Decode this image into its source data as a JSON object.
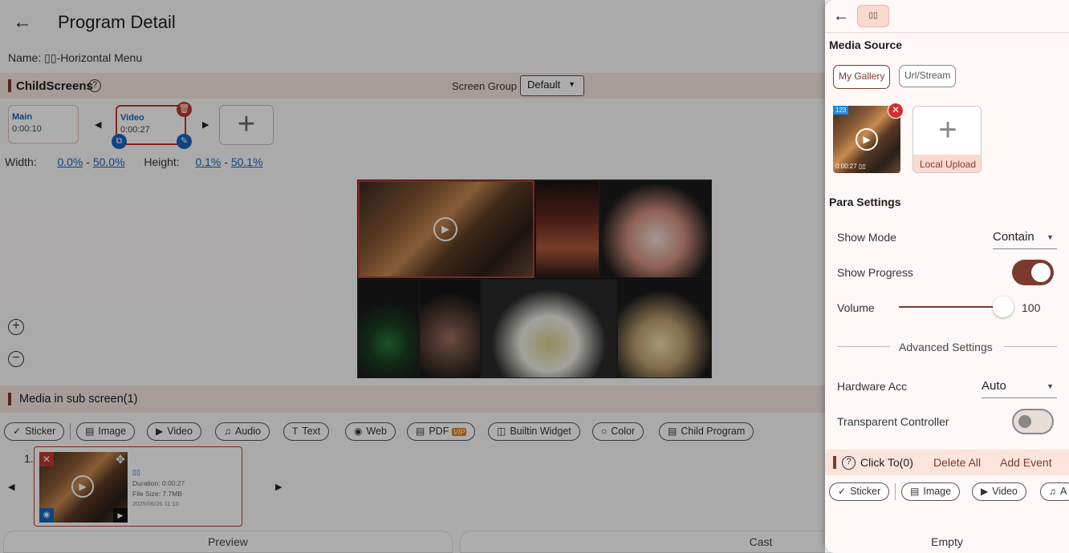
{
  "header": {
    "back_icon": "arrow-left-icon",
    "title": "Program Detail"
  },
  "program": {
    "name_line": "Name: ▯▯-Horizontal Menu"
  },
  "child_screens": {
    "label": "ChildScreens",
    "screen_group_label": "Screen Group",
    "screen_group_value": "Default",
    "items": [
      {
        "title": "Main",
        "duration": "0:00:10"
      },
      {
        "title": "Video",
        "duration": "0:00:27"
      }
    ],
    "dims": {
      "width_label": "Width:",
      "width_from": "0.0%",
      "width_to": "50.0%",
      "height_label": "Height:",
      "height_from": "0.1%",
      "height_to": "50.1%",
      "separator": "-"
    }
  },
  "media_section": {
    "label": "Media in sub screen(1)",
    "chips": [
      "Sticker",
      "Image",
      "Video",
      "Audio",
      "Text",
      "Web",
      "PDF",
      "Builtin Widget",
      "Color",
      "Child Program"
    ],
    "vip_badge": "VIP",
    "index": "1.",
    "item": {
      "title": "▯▯",
      "duration": "Duration: 0:00:27",
      "size": "File Size: 7.7MB",
      "date": "2025/06/26 11:10"
    }
  },
  "bottom": {
    "preview": "Preview",
    "cast": "Cast"
  },
  "panel": {
    "back_icon": "arrow-left-icon",
    "tag": "▯▯",
    "media_source": "Media Source",
    "source_tabs": [
      "My Gallery",
      "Url/Stream"
    ],
    "gallery_badge": "123",
    "gallery_duration": "0:00:27 ▯▯",
    "local_upload": "Local Upload",
    "para_settings": "Para Settings",
    "show_mode_label": "Show Mode",
    "show_mode_value": "Contain",
    "show_progress_label": "Show Progress",
    "show_progress_on": true,
    "volume_label": "Volume",
    "volume_value": "100",
    "volume_level": 1.0,
    "advanced": "Advanced Settings",
    "hw_label": "Hardware Acc",
    "hw_value": "Auto",
    "transparent_label": "Transparent Controller",
    "transparent_on": false,
    "click_to": "Click To(0)",
    "delete_all": "Delete All",
    "add_event": "Add Event",
    "chips": [
      "Sticker",
      "Image",
      "Video",
      "A"
    ],
    "empty": "Empty",
    "accent": "#7a3b2e"
  }
}
